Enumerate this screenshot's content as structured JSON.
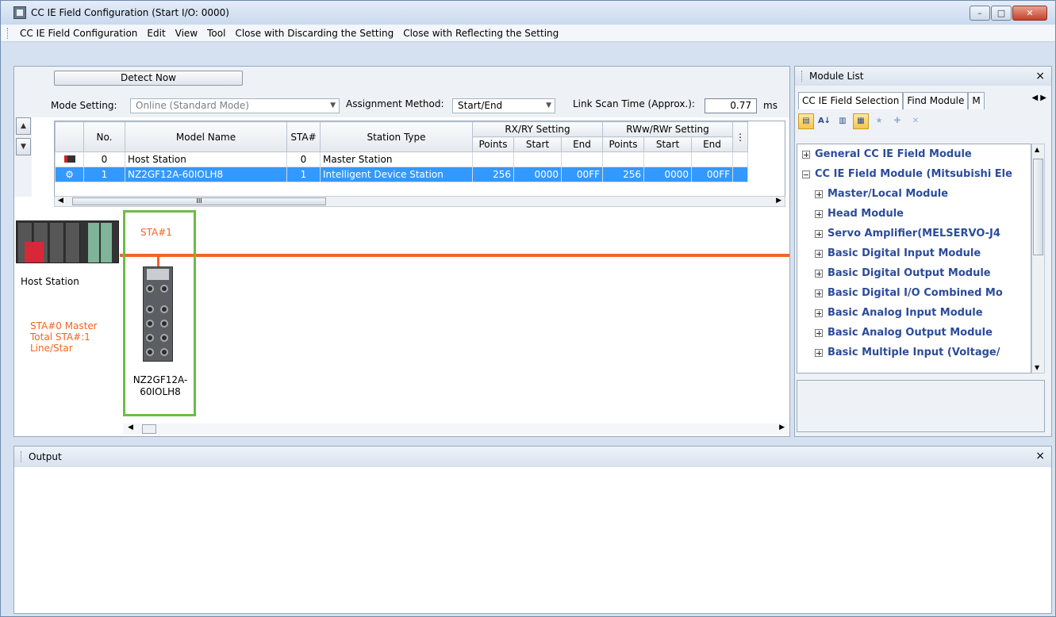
{
  "window": {
    "title": "CC IE Field Configuration (Start I/O: 0000)",
    "minimize": "–",
    "restore": "□",
    "close": "✕"
  },
  "menu": {
    "items": [
      "CC IE Field Configuration",
      "Edit",
      "View",
      "Tool",
      "Close with Discarding the Setting",
      "Close with Reflecting the Setting"
    ]
  },
  "config": {
    "detect_now": "Detect Now",
    "mode_label": "Mode Setting:",
    "mode_value": "Online (Standard Mode)",
    "assign_label": "Assignment Method:",
    "assign_value": "Start/End",
    "linkscan_label": "Link Scan Time (Approx.):",
    "linkscan_value": "0.77",
    "linkscan_unit": "ms"
  },
  "table": {
    "headers": {
      "no": "No.",
      "model": "Model Name",
      "sta": "STA#",
      "type": "Station Type",
      "rxry": "RX/RY Setting",
      "rwwrwr": "RWw/RWr Setting",
      "points": "Points",
      "start": "Start",
      "end": "End"
    },
    "rows": [
      {
        "no": "0",
        "model": "Host Station",
        "sta": "0",
        "type": "Master Station",
        "rx_points": "",
        "rx_start": "",
        "rx_end": "",
        "rw_points": "",
        "rw_start": "",
        "rw_end": ""
      },
      {
        "no": "1",
        "model": "NZ2GF12A-60IOLH8",
        "sta": "1",
        "type": "Intelligent Device Station",
        "rx_points": "256",
        "rx_start": "0000",
        "rx_end": "00FF",
        "rw_points": "256",
        "rw_start": "0000",
        "rw_end": "00FF"
      }
    ],
    "scroll_grip": "III"
  },
  "diagram": {
    "host_label": "Host Station",
    "host_info": [
      "STA#0  Master",
      "Total STA#:1",
      "Line/Star"
    ],
    "station_label": "STA#1",
    "device_name_1": "NZ2GF12A-",
    "device_name_2": "60IOLH8",
    "accent_color": "#f26522",
    "selection_color": "#6abe45"
  },
  "module_list": {
    "title": "Module List",
    "close": "×",
    "tabs": [
      "CC IE Field Selection",
      "Find Module",
      "M"
    ],
    "items": [
      {
        "label": "General CC IE Field Module",
        "expanded": false,
        "level": 0
      },
      {
        "label": "CC IE Field Module (Mitsubishi Ele",
        "expanded": true,
        "level": 0
      },
      {
        "label": "Master/Local Module",
        "expanded": false,
        "level": 1
      },
      {
        "label": "Head Module",
        "expanded": false,
        "level": 1
      },
      {
        "label": "Servo Amplifier(MELSERVO-J4",
        "expanded": false,
        "level": 1
      },
      {
        "label": "Basic Digital Input Module",
        "expanded": false,
        "level": 1
      },
      {
        "label": "Basic Digital Output Module",
        "expanded": false,
        "level": 1
      },
      {
        "label": "Basic Digital I/O Combined Mo",
        "expanded": false,
        "level": 1
      },
      {
        "label": "Basic Analog Input Module",
        "expanded": false,
        "level": 1
      },
      {
        "label": "Basic Analog Output Module",
        "expanded": false,
        "level": 1
      },
      {
        "label": "Basic Multiple Input (Voltage/",
        "expanded": false,
        "level": 1
      }
    ]
  },
  "output": {
    "title": "Output",
    "close": "×"
  }
}
